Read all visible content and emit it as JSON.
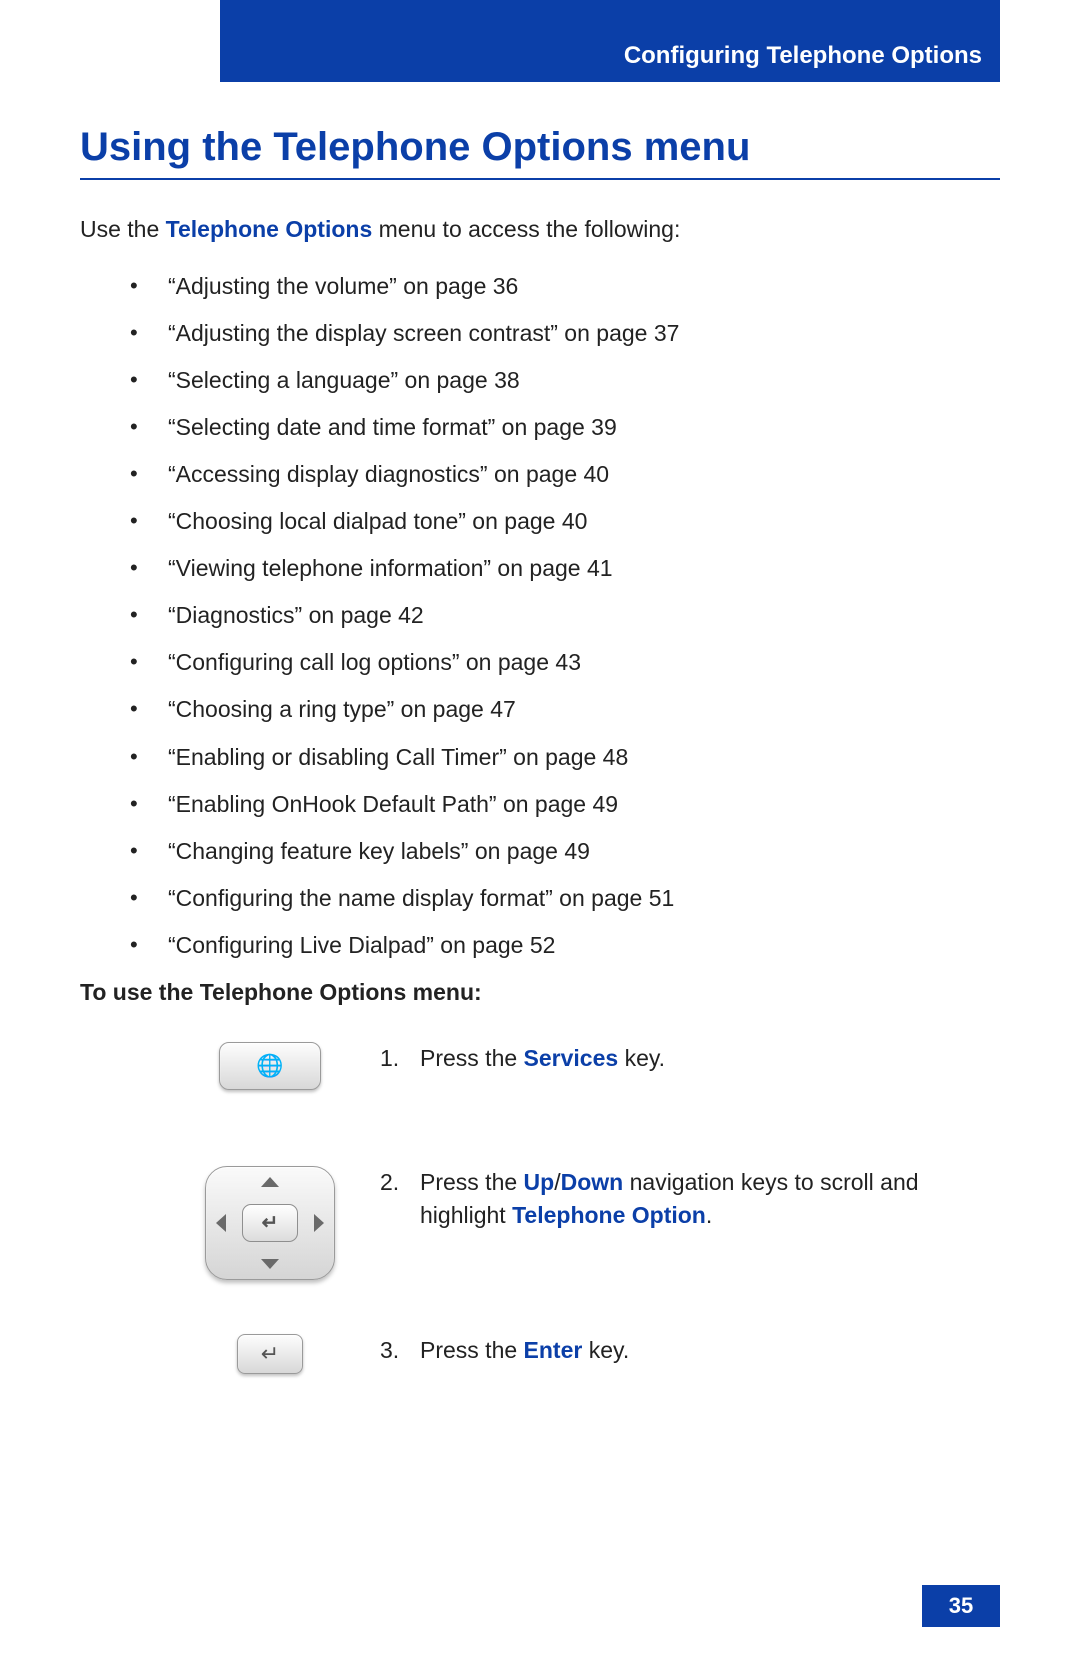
{
  "header": {
    "running_title": "Configuring Telephone Options"
  },
  "title": "Using the Telephone Options menu",
  "intro": {
    "prefix": "Use the ",
    "strong": "Telephone Options",
    "suffix": " menu to access the following:"
  },
  "bullets": [
    "“Adjusting the volume” on page 36",
    "“Adjusting the display screen contrast” on page 37",
    "“Selecting a language” on page 38",
    "“Selecting date and time format” on page 39",
    "“Accessing display diagnostics” on page 40",
    "“Choosing local dialpad tone” on page 40",
    "“Viewing telephone information” on page 41",
    "“Diagnostics” on page 42",
    "“Configuring call log options” on page 43",
    "“Choosing a ring type” on page 47",
    "“Enabling or disabling Call Timer” on page 48",
    "“Enabling OnHook Default Path” on page 49",
    "“Changing feature key labels” on page 49",
    "“Configuring the name display format” on page 51",
    "“Configuring Live Dialpad” on page 52"
  ],
  "subhead": "To use the Telephone Options menu:",
  "steps": [
    {
      "num": "1.",
      "segments": [
        {
          "text": "Press the "
        },
        {
          "text": "Services",
          "blue": true
        },
        {
          "text": " key."
        }
      ],
      "icon": "services"
    },
    {
      "num": "2.",
      "segments": [
        {
          "text": "Press the "
        },
        {
          "text": "Up",
          "blue": true
        },
        {
          "text": "/"
        },
        {
          "text": "Down",
          "blue": true
        },
        {
          "text": " navigation keys to scroll and highlight "
        },
        {
          "text": "Telephone Option",
          "blue": true
        },
        {
          "text": "."
        }
      ],
      "icon": "navpad"
    },
    {
      "num": "3.",
      "segments": [
        {
          "text": "Press the "
        },
        {
          "text": "Enter",
          "blue": true
        },
        {
          "text": " key."
        }
      ],
      "icon": "enter"
    }
  ],
  "page_number": "35"
}
